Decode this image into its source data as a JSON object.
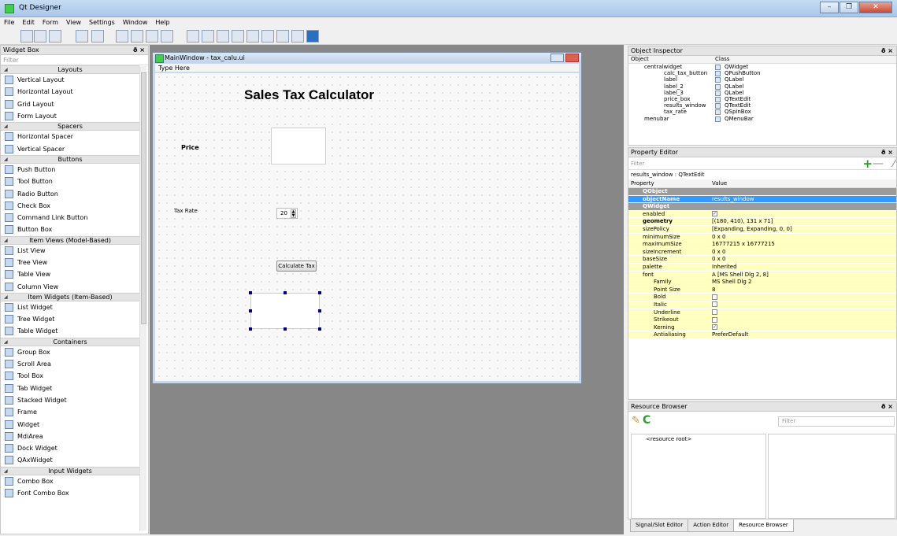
{
  "app": {
    "title": "Qt Designer"
  },
  "menu": [
    "File",
    "Edit",
    "Form",
    "View",
    "Settings",
    "Window",
    "Help"
  ],
  "widget_box": {
    "title": "Widget Box",
    "filter_placeholder": "Filter",
    "items": [
      {
        "type": "cat",
        "label": "Layouts"
      },
      {
        "type": "item",
        "label": "Vertical Layout"
      },
      {
        "type": "item",
        "label": "Horizontal Layout"
      },
      {
        "type": "item",
        "label": "Grid Layout"
      },
      {
        "type": "item",
        "label": "Form Layout"
      },
      {
        "type": "cat",
        "label": "Spacers"
      },
      {
        "type": "item",
        "label": "Horizontal Spacer"
      },
      {
        "type": "item",
        "label": "Vertical Spacer"
      },
      {
        "type": "cat",
        "label": "Buttons"
      },
      {
        "type": "item",
        "label": "Push Button"
      },
      {
        "type": "item",
        "label": "Tool Button"
      },
      {
        "type": "item",
        "label": "Radio Button"
      },
      {
        "type": "item",
        "label": "Check Box"
      },
      {
        "type": "item",
        "label": "Command Link Button"
      },
      {
        "type": "item",
        "label": "Button Box"
      },
      {
        "type": "cat",
        "label": "Item Views (Model-Based)"
      },
      {
        "type": "item",
        "label": "List View"
      },
      {
        "type": "item",
        "label": "Tree View"
      },
      {
        "type": "item",
        "label": "Table View"
      },
      {
        "type": "item",
        "label": "Column View"
      },
      {
        "type": "cat",
        "label": "Item Widgets (Item-Based)"
      },
      {
        "type": "item",
        "label": "List Widget"
      },
      {
        "type": "item",
        "label": "Tree Widget"
      },
      {
        "type": "item",
        "label": "Table Widget"
      },
      {
        "type": "cat",
        "label": "Containers"
      },
      {
        "type": "item",
        "label": "Group Box"
      },
      {
        "type": "item",
        "label": "Scroll Area"
      },
      {
        "type": "item",
        "label": "Tool Box"
      },
      {
        "type": "item",
        "label": "Tab Widget"
      },
      {
        "type": "item",
        "label": "Stacked Widget"
      },
      {
        "type": "item",
        "label": "Frame"
      },
      {
        "type": "item",
        "label": "Widget"
      },
      {
        "type": "item",
        "label": "MdiArea"
      },
      {
        "type": "item",
        "label": "Dock Widget"
      },
      {
        "type": "item",
        "label": "QAxWidget"
      },
      {
        "type": "cat",
        "label": "Input Widgets"
      },
      {
        "type": "item",
        "label": "Combo Box"
      },
      {
        "type": "item",
        "label": "Font Combo Box"
      }
    ]
  },
  "form_window": {
    "title": "MainWindow - tax_calu.ui",
    "menu_placeholder": "Type Here",
    "heading": "Sales Tax Calculator",
    "price_label": "Price",
    "tax_label": "Tax Rate",
    "tax_value": "20",
    "button_label": "Calculate Tax"
  },
  "object_inspector": {
    "title": "Object Inspector",
    "col_object": "Object",
    "col_class": "Class",
    "rows": [
      {
        "name": "centralwidget",
        "cls": "QWidget",
        "indent": 0
      },
      {
        "name": "calc_tax_button",
        "cls": "QPushButton",
        "indent": 1
      },
      {
        "name": "label",
        "cls": "QLabel",
        "indent": 1
      },
      {
        "name": "label_2",
        "cls": "QLabel",
        "indent": 1
      },
      {
        "name": "label_3",
        "cls": "QLabel",
        "indent": 1
      },
      {
        "name": "price_box",
        "cls": "QTextEdit",
        "indent": 1
      },
      {
        "name": "results_window",
        "cls": "QTextEdit",
        "indent": 1
      },
      {
        "name": "tax_rate",
        "cls": "QSpinBox",
        "indent": 1
      },
      {
        "name": "menubar",
        "cls": "QMenuBar",
        "indent": 0
      }
    ]
  },
  "property_editor": {
    "title": "Property Editor",
    "filter_placeholder": "Filter",
    "context": "results_window : QTextEdit",
    "col_property": "Property",
    "col_value": "Value",
    "rows": [
      {
        "k": "QObject",
        "v": "",
        "s": "grp"
      },
      {
        "k": "objectName",
        "v": "results_window",
        "s": "sel"
      },
      {
        "k": "QWidget",
        "v": "",
        "s": "grp"
      },
      {
        "k": "enabled",
        "v": "",
        "s": "",
        "cb": true
      },
      {
        "k": "geometry",
        "v": "[(180, 410), 131 x 71]",
        "s": "bold"
      },
      {
        "k": "sizePolicy",
        "v": "[Expanding, Expanding, 0, 0]",
        "s": ""
      },
      {
        "k": "minimumSize",
        "v": "0 x 0",
        "s": ""
      },
      {
        "k": "maximumSize",
        "v": "16777215 x 16777215",
        "s": ""
      },
      {
        "k": "sizeIncrement",
        "v": "0 x 0",
        "s": ""
      },
      {
        "k": "baseSize",
        "v": "0 x 0",
        "s": ""
      },
      {
        "k": "palette",
        "v": "Inherited",
        "s": ""
      },
      {
        "k": "font",
        "v": "A  [MS Shell Dlg 2, 8]",
        "s": ""
      },
      {
        "k": "Family",
        "v": "MS Shell Dlg 2",
        "s": "sub"
      },
      {
        "k": "Point Size",
        "v": "8",
        "s": "sub"
      },
      {
        "k": "Bold",
        "v": "",
        "s": "sub",
        "cb": false
      },
      {
        "k": "Italic",
        "v": "",
        "s": "sub",
        "cb": false
      },
      {
        "k": "Underline",
        "v": "",
        "s": "sub",
        "cb": false
      },
      {
        "k": "Strikeout",
        "v": "",
        "s": "sub",
        "cb": false
      },
      {
        "k": "Kerning",
        "v": "",
        "s": "sub",
        "cb": true
      },
      {
        "k": "Antialiasing",
        "v": "PreferDefault",
        "s": "sub"
      }
    ]
  },
  "resource_browser": {
    "title": "Resource Browser",
    "filter_placeholder": "Filter",
    "root": "<resource root>"
  },
  "tabs": [
    "Signal/Slot Editor",
    "Action Editor",
    "Resource Browser"
  ]
}
